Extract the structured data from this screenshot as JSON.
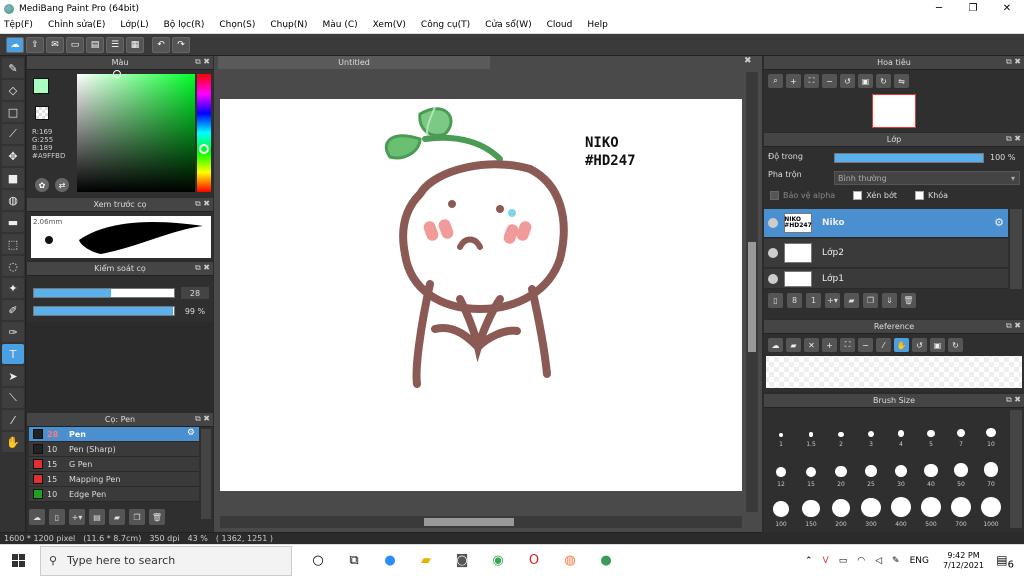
{
  "window": {
    "title": "MediBang Paint Pro (64bit)"
  },
  "menu": [
    "Tệp(F)",
    "Chỉnh sửa(E)",
    "Lớp(L)",
    "Bộ lọc(R)",
    "Chọn(S)",
    "Chụp(N)",
    "Màu (C)",
    "Xem(V)",
    "Công cụ(T)",
    "Cửa sổ(W)",
    "Cloud",
    "Help"
  ],
  "color_panel": {
    "title": "Màu",
    "r": "R:169",
    "g": "G:255",
    "b": "B:189",
    "hex": "#A9FFBD",
    "foreground": "#A9FFBD"
  },
  "brush_preview": {
    "title": "Xem trước cọ",
    "size": "2.06mm"
  },
  "brush_control": {
    "title": "Kiểm soát cọ",
    "size_value": "28",
    "opacity_value": "99 %",
    "size_fraction": 0.55,
    "opacity_fraction": 0.99
  },
  "brush_list": {
    "title": "Cọ: Pen",
    "items": [
      {
        "size": "28",
        "name": "Pen",
        "color": "#222222",
        "active": true
      },
      {
        "size": "10",
        "name": "Pen (Sharp)",
        "color": "#222222"
      },
      {
        "size": "15",
        "name": "G Pen",
        "color": "#e03030"
      },
      {
        "size": "15",
        "name": "Mapping Pen",
        "color": "#e03030"
      },
      {
        "size": "10",
        "name": "Edge Pen",
        "color": "#20a020"
      }
    ]
  },
  "canvas": {
    "tab": "Untitled",
    "text_line1": "NIKO",
    "text_line2": "#HD247"
  },
  "status": {
    "size": "1600 * 1200 pixel",
    "physical": "(11.6 * 8.7cm)",
    "dpi": "350 dpi",
    "zoom": "43 %",
    "coords": "( 1362, 1251 )"
  },
  "navigator": {
    "title": "Hoa tiêu"
  },
  "layer_panel": {
    "title": "Lớp",
    "opacity_label": "Độ trong",
    "opacity_value": "100 %",
    "blend_label": "Pha trộn",
    "blend_value": "Bình thường",
    "protect_alpha": "Bảo vệ alpha",
    "clipping": "Xén bớt",
    "lock": "Khóa",
    "layers": [
      {
        "name": "Niko",
        "thumb": "NIKO #HD247",
        "active": true
      },
      {
        "name": "Lớp2",
        "thumb": ""
      },
      {
        "name": "Lớp1",
        "thumb": ""
      }
    ]
  },
  "reference": {
    "title": "Reference"
  },
  "brush_size": {
    "title": "Brush Size",
    "sizes": [
      "1",
      "1.5",
      "2",
      "3",
      "4",
      "5",
      "7",
      "10",
      "12",
      "15",
      "20",
      "25",
      "30",
      "40",
      "50",
      "70",
      "100",
      "150",
      "200",
      "300",
      "400",
      "500",
      "700",
      "1000"
    ]
  },
  "taskbar": {
    "search_placeholder": "Type here to search",
    "language": "ENG",
    "time": "9:42 PM",
    "date": "7/12/2021",
    "notifications": "6"
  }
}
